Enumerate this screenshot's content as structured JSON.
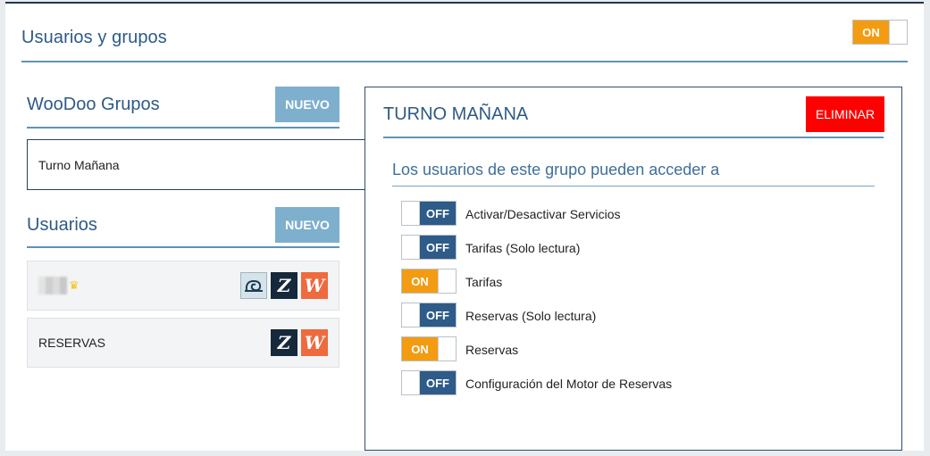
{
  "header": {
    "title": "Usuarios y grupos",
    "toggle": {
      "state": "ON"
    }
  },
  "groups": {
    "title": "WooDoo Grupos",
    "new_label": "NUEVO",
    "items": [
      {
        "label": "Turno Mañana"
      }
    ]
  },
  "users": {
    "title": "Usuarios",
    "new_label": "NUEVO",
    "items": [
      {
        "label": "",
        "crown_icon": "crown-icon",
        "badges": [
          "snail-icon",
          "Z",
          "W"
        ]
      },
      {
        "label": "RESERVAS",
        "badges": [
          "Z",
          "W"
        ]
      }
    ]
  },
  "group_detail": {
    "title": "TURNO MAÑANA",
    "delete_label": "ELIMINAR",
    "access_heading": "Los usuarios de este grupo pueden acceder a",
    "permissions": [
      {
        "label": "Activar/Desactivar Servicios",
        "state": "OFF"
      },
      {
        "label": "Tarifas (Solo lectura)",
        "state": "OFF"
      },
      {
        "label": "Tarifas",
        "state": "ON"
      },
      {
        "label": "Reservas (Solo lectura)",
        "state": "OFF"
      },
      {
        "label": "Reservas",
        "state": "ON"
      },
      {
        "label": "Configuración del Motor de Reservas",
        "state": "OFF"
      }
    ]
  },
  "colors": {
    "accent_on": "#f39c12",
    "accent_off": "#2e5b88",
    "title": "#2e5a86",
    "delete": "#ff0000",
    "nuevo": "#7eafcd"
  }
}
